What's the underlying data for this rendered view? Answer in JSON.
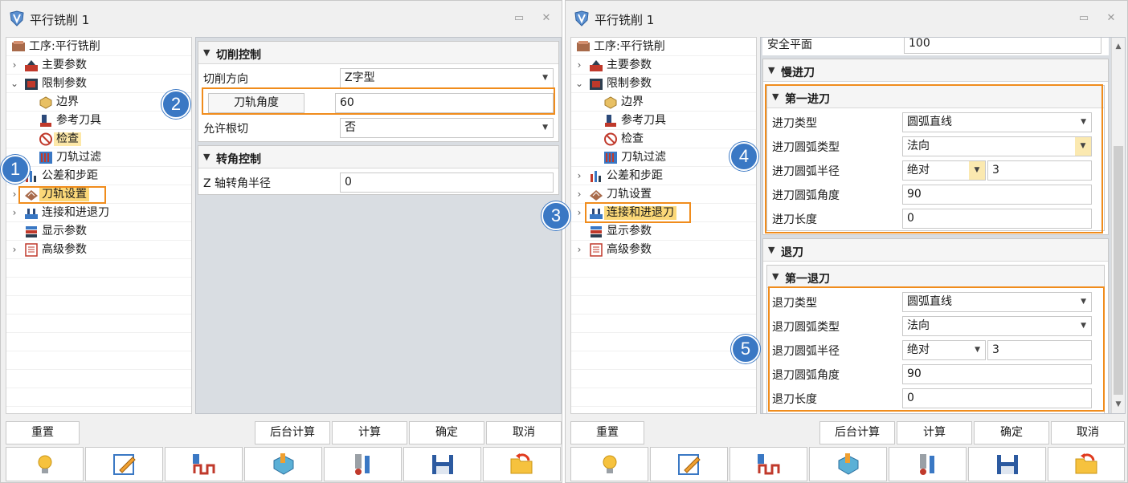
{
  "left": {
    "title": "平行铣削 1",
    "tree": [
      "工序:平行铣削",
      "主要参数",
      "限制参数",
      "边界",
      "参考刀具",
      "检查",
      "刀轨过滤",
      "公差和步距",
      "刀轨设置",
      "连接和进退刀",
      "显示参数",
      "高级参数"
    ],
    "sec_cut": "切削控制",
    "cut_dir_label": "切削方向",
    "cut_dir_value": "Z字型",
    "angle_label": "刀轨角度",
    "angle_value": "60",
    "undercut_label": "允许根切",
    "undercut_value": "否",
    "sec_corner": "转角控制",
    "z_radius_label": "Z 轴转角半径",
    "z_radius_value": "0",
    "badges": [
      "1",
      "2"
    ]
  },
  "right": {
    "title": "平行铣削 1",
    "tree": [
      "工序:平行铣削",
      "主要参数",
      "限制参数",
      "边界",
      "参考刀具",
      "检查",
      "刀轨过滤",
      "公差和步距",
      "刀轨设置",
      "连接和进退刀",
      "显示参数",
      "高级参数"
    ],
    "safe_label": "安全平面",
    "safe_value": "100",
    "sec_slow": "慢进刀",
    "sec_first_in": "第一进刀",
    "in_type_label": "进刀类型",
    "in_type_value": "圆弧直线",
    "in_arc_type_label": "进刀圆弧类型",
    "in_arc_type_value": "法向",
    "in_radius_label": "进刀圆弧半径",
    "in_radius_mode": "绝对",
    "in_radius_value": "3",
    "in_angle_label": "进刀圆弧角度",
    "in_angle_value": "90",
    "in_len_label": "进刀长度",
    "in_len_value": "0",
    "sec_out": "退刀",
    "sec_first_out": "第一退刀",
    "out_type_label": "退刀类型",
    "out_type_value": "圆弧直线",
    "out_arc_type_label": "退刀圆弧类型",
    "out_arc_type_value": "法向",
    "out_radius_label": "退刀圆弧半径",
    "out_radius_mode": "绝对",
    "out_radius_value": "3",
    "out_angle_label": "退刀圆弧角度",
    "out_angle_value": "90",
    "out_len_label": "退刀长度",
    "out_len_value": "0",
    "badges": [
      "3",
      "4",
      "5"
    ]
  },
  "buttons": {
    "reset": "重置",
    "bg_calc": "后台计算",
    "calc": "计算",
    "ok": "确定",
    "cancel": "取消"
  },
  "icons": [
    "lightbulb-icon",
    "edit-icon",
    "toolpath-icon",
    "tool-3d-icon",
    "tool-holder-icon",
    "save-icon",
    "folder-open-icon"
  ],
  "colors": {
    "highlight_box": "#f08c1c",
    "badge": "#3a78c4",
    "selected_item": "#fbd878"
  }
}
